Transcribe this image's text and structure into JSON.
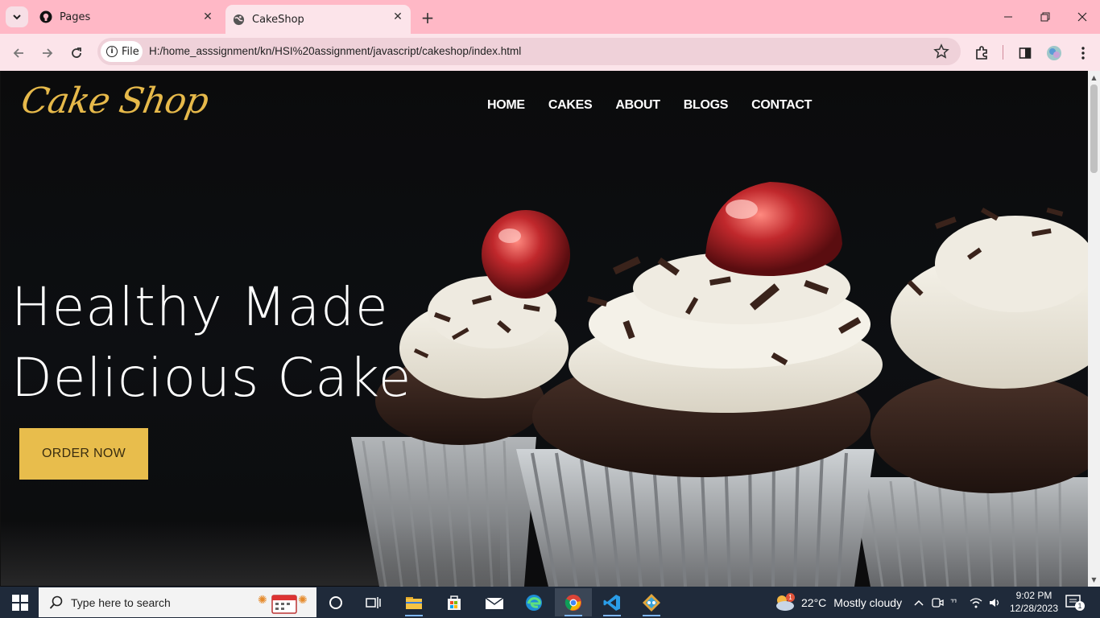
{
  "browser": {
    "tabs": [
      {
        "label": "Pages",
        "icon": "github-icon",
        "active": false
      },
      {
        "label": "CakeShop",
        "icon": "globe-icon",
        "active": true
      }
    ],
    "address": {
      "scheme_chip": "File",
      "url": "H:/home_asssignment/kn/HSI%20assignment/javascript/cakeshop/index.html"
    }
  },
  "site": {
    "logo": "Cake Shop",
    "nav": [
      "HOME",
      "CAKES",
      "ABOUT",
      "BLOGS",
      "CONTACT"
    ],
    "hero": {
      "line1": "Healthy Made",
      "line2": "Delicious Cake",
      "cta": "ORDER NOW"
    },
    "colors": {
      "accent": "#e8bd4c",
      "background": "#0b0b0c",
      "nav_text": "#ffffff"
    }
  },
  "taskbar": {
    "search_placeholder": "Type here to search",
    "weather": {
      "temp": "22°C",
      "condition": "Mostly cloudy",
      "badge": "1"
    },
    "time": "9:02 PM",
    "date": "12/28/2023",
    "notifications": "1"
  }
}
